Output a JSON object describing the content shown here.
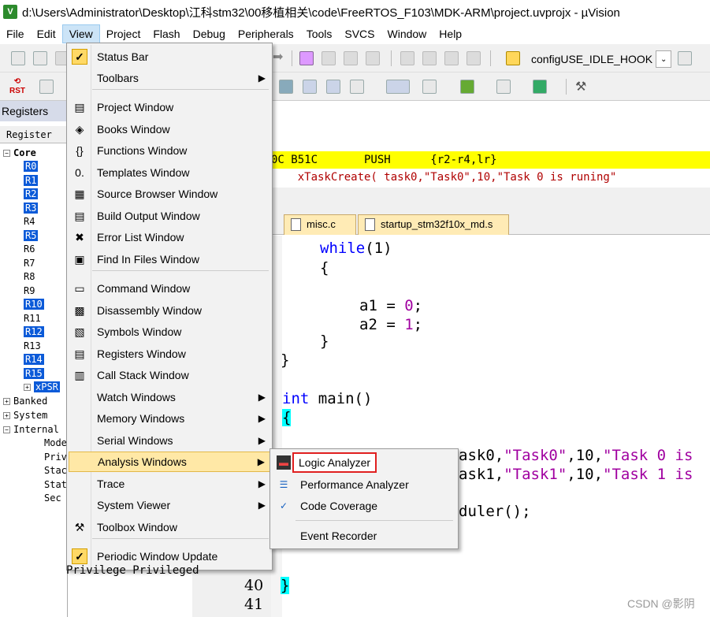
{
  "window": {
    "title": "d:\\Users\\Administrator\\Desktop\\江科stm32\\00移植相关\\code\\FreeRTOS_F103\\MDK-ARM\\project.uvprojx - µVision",
    "icon_text": "V"
  },
  "menubar": [
    "File",
    "Edit",
    "View",
    "Project",
    "Flash",
    "Debug",
    "Peripherals",
    "Tools",
    "SVCS",
    "Window",
    "Help"
  ],
  "toolbar": {
    "combo_label": "configUSE_IDLE_HOOK",
    "rst_label": "RST"
  },
  "registers": {
    "panel_title": "Registers",
    "col_header": "Register",
    "core_label": "Core",
    "rows": [
      {
        "name": "R0",
        "sel": true
      },
      {
        "name": "R1",
        "sel": true
      },
      {
        "name": "R2",
        "sel": true
      },
      {
        "name": "R3",
        "sel": true
      },
      {
        "name": "R4",
        "sel": false
      },
      {
        "name": "R5",
        "sel": true
      },
      {
        "name": "R6",
        "sel": false
      },
      {
        "name": "R7",
        "sel": false
      },
      {
        "name": "R8",
        "sel": false
      },
      {
        "name": "R9",
        "sel": false
      },
      {
        "name": "R10",
        "sel": true
      },
      {
        "name": "R11",
        "sel": false
      },
      {
        "name": "R12",
        "sel": true
      },
      {
        "name": "R13",
        "sel": false
      },
      {
        "name": "R14",
        "sel": true
      },
      {
        "name": "R15",
        "sel": true
      },
      {
        "name": "xPSR",
        "sel": true
      }
    ],
    "groups": [
      "Banked",
      "System",
      "Internal"
    ],
    "internal_children": [
      "Mode",
      "Priv",
      "Stack",
      "State",
      "Sec"
    ],
    "bottom_text": "Privilege   Privileged"
  },
  "disassembly": {
    "line1": "0C B51C       PUSH      {r2-r4,lr}",
    "line2": "    xTaskCreate( task0,\"Task0\",10,\"Task 0 is runing\""
  },
  "tabs": [
    "misc.c",
    "startup_stm32f10x_md.s"
  ],
  "code": {
    "while_kw": "while",
    "while_arg": "(1)",
    "open_brace": "{",
    "a1": "a1 = ",
    "a1_val": "0",
    "a2": "a2 = ",
    "a2_val": "1",
    "semi": ";",
    "close_brace": "}",
    "close_brace2": "}",
    "int_kw": "int",
    "main_sig": " main()",
    "main_open": "{",
    "task0_pre": "ask0,",
    "task0_str": "\"Task0\"",
    "task0_mid": ",10,",
    "task0_str2": "\"Task 0 is",
    "task1_pre": "ask1,",
    "task1_str": "\"Task1\"",
    "task1_str2": "\"Task 1 is",
    "sched": "duler();",
    "final_brace": "}",
    "line40": "40",
    "line41": "41"
  },
  "view_menu": {
    "items": [
      {
        "label": "Status Bar",
        "icon": "check-icon",
        "sym": "✓",
        "check": true
      },
      {
        "label": "Toolbars",
        "icon": "",
        "sym": "",
        "sub": true
      },
      {
        "label": "Project Window",
        "icon": "project-window-icon",
        "sym": "▤"
      },
      {
        "label": "Books Window",
        "icon": "books-icon",
        "sym": "◈"
      },
      {
        "label": "Functions Window",
        "icon": "functions-icon",
        "sym": "{}"
      },
      {
        "label": "Templates Window",
        "icon": "templates-icon",
        "sym": "0."
      },
      {
        "label": "Source Browser Window",
        "icon": "source-browser-icon",
        "sym": "▦"
      },
      {
        "label": "Build Output Window",
        "icon": "build-output-icon",
        "sym": "▤"
      },
      {
        "label": "Error List Window",
        "icon": "error-list-icon",
        "sym": "✖"
      },
      {
        "label": "Find In Files Window",
        "icon": "find-in-files-icon",
        "sym": "▣"
      },
      {
        "label": "Command Window",
        "icon": "command-window-icon",
        "sym": "▭"
      },
      {
        "label": "Disassembly Window",
        "icon": "disassembly-icon",
        "sym": "▩"
      },
      {
        "label": "Symbols Window",
        "icon": "symbols-icon",
        "sym": "▧"
      },
      {
        "label": "Registers Window",
        "icon": "registers-icon",
        "sym": "▤"
      },
      {
        "label": "Call Stack Window",
        "icon": "call-stack-icon",
        "sym": "▥"
      },
      {
        "label": "Watch Windows",
        "icon": "",
        "sym": "",
        "sub": true
      },
      {
        "label": "Memory Windows",
        "icon": "",
        "sym": "",
        "sub": true
      },
      {
        "label": "Serial Windows",
        "icon": "",
        "sym": "",
        "sub": true
      },
      {
        "label": "Analysis Windows",
        "icon": "",
        "sym": "",
        "sub": true,
        "hl": true
      },
      {
        "label": "Trace",
        "icon": "",
        "sym": "",
        "sub": true
      },
      {
        "label": "System Viewer",
        "icon": "",
        "sym": "",
        "sub": true
      },
      {
        "label": "Toolbox Window",
        "icon": "toolbox-icon",
        "sym": "⚒"
      },
      {
        "label": "Periodic Window Update",
        "icon": "check-icon",
        "sym": "✓",
        "check": true
      }
    ]
  },
  "analysis_submenu": {
    "items": [
      {
        "label": "Logic Analyzer",
        "icon": "logic-analyzer-icon",
        "sym": "▬",
        "boxed": true
      },
      {
        "label": "Performance Analyzer",
        "icon": "performance-analyzer-icon",
        "sym": "☰"
      },
      {
        "label": "Code Coverage",
        "icon": "code-coverage-icon",
        "sym": "✓"
      },
      {
        "label": "Event Recorder",
        "icon": "",
        "sym": ""
      }
    ]
  },
  "watermark": "CSDN @影阴"
}
